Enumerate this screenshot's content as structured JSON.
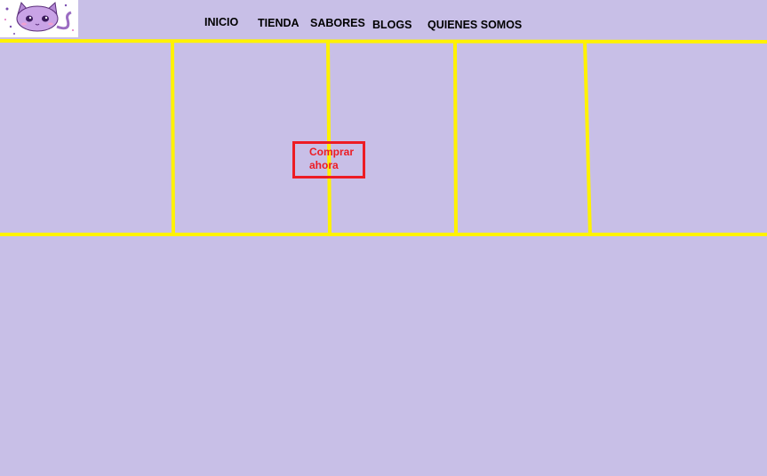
{
  "header": {
    "logo_icon": "cat-logo-icon",
    "nav": [
      {
        "label": "INICIO"
      },
      {
        "label": "TIENDA"
      },
      {
        "label": "SABORES"
      },
      {
        "label": "BLOGS"
      },
      {
        "label": "QUIENES SOMOS"
      }
    ]
  },
  "hero": {
    "buy_label_line1": "Comprar",
    "buy_label_line2": "ahora"
  },
  "colors": {
    "background": "#c8bfe7",
    "grid_lines": "#fff200",
    "button_accent": "#ed1c24"
  }
}
